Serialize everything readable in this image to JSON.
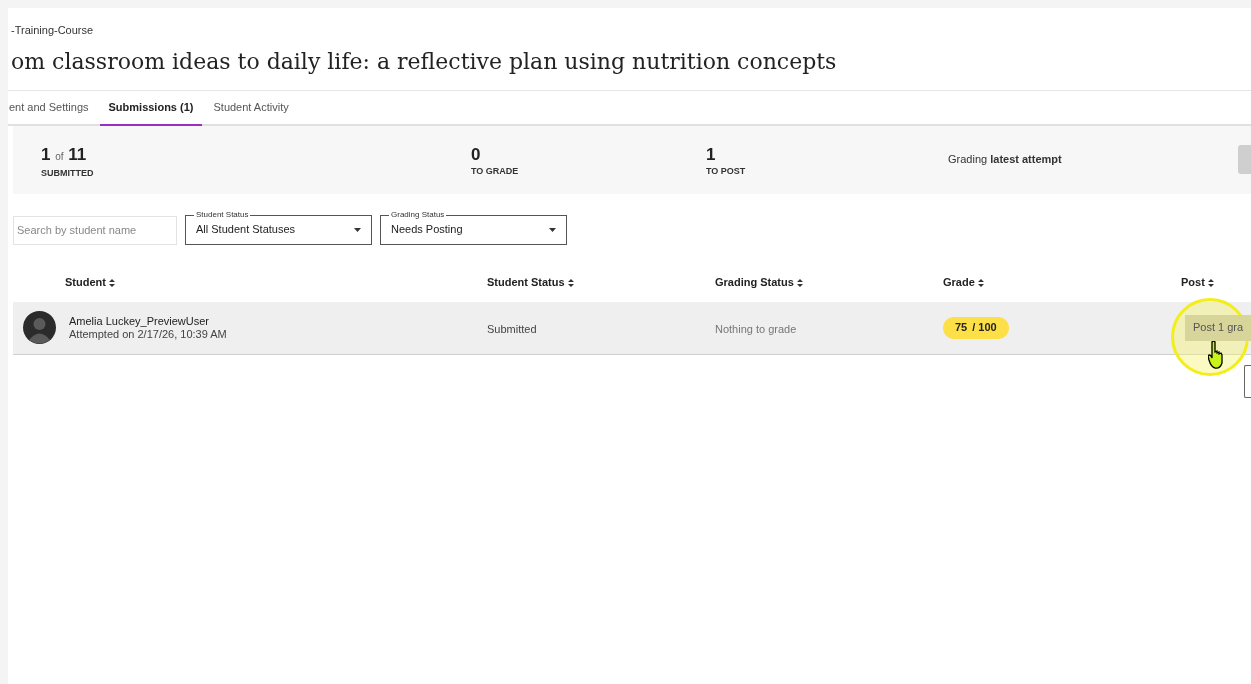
{
  "breadcrumb": "-Training-Course",
  "title": "om classroom ideas to daily life: a reflective plan using nutrition concepts",
  "tabs": [
    {
      "label": "ent and Settings",
      "selected": false
    },
    {
      "label": "Submissions (1)",
      "selected": true
    },
    {
      "label": "Student Activity",
      "selected": false
    }
  ],
  "stats": [
    {
      "value": "1",
      "of": "of",
      "total": "11",
      "label": "SUBMITTED"
    },
    {
      "value": "0",
      "label": "TO GRADE"
    },
    {
      "value": "1",
      "label": "TO POST"
    }
  ],
  "grading_mode": "Grading **latest attempt**",
  "search": {
    "placeholder": "Search by student name"
  },
  "filters": [
    {
      "label": "Student Status",
      "value": "All Student Statuses"
    },
    {
      "label": "Grading Status",
      "value": "Needs Posting"
    }
  ],
  "table": {
    "columns": [
      "Student",
      "Student Status",
      "Grading Status",
      "Grade",
      "Post"
    ],
    "rows": [
      {
        "name": "Amelia Luckey_PreviewUser",
        "attempted": "Attempted on 2/17/26, 10:39 AM",
        "student_status": "Submitted",
        "grading_status": "Nothing to grade",
        "grade": "75",
        "grade_total": "/ 100",
        "post": "Post 1 gra"
      }
    ]
  }
}
